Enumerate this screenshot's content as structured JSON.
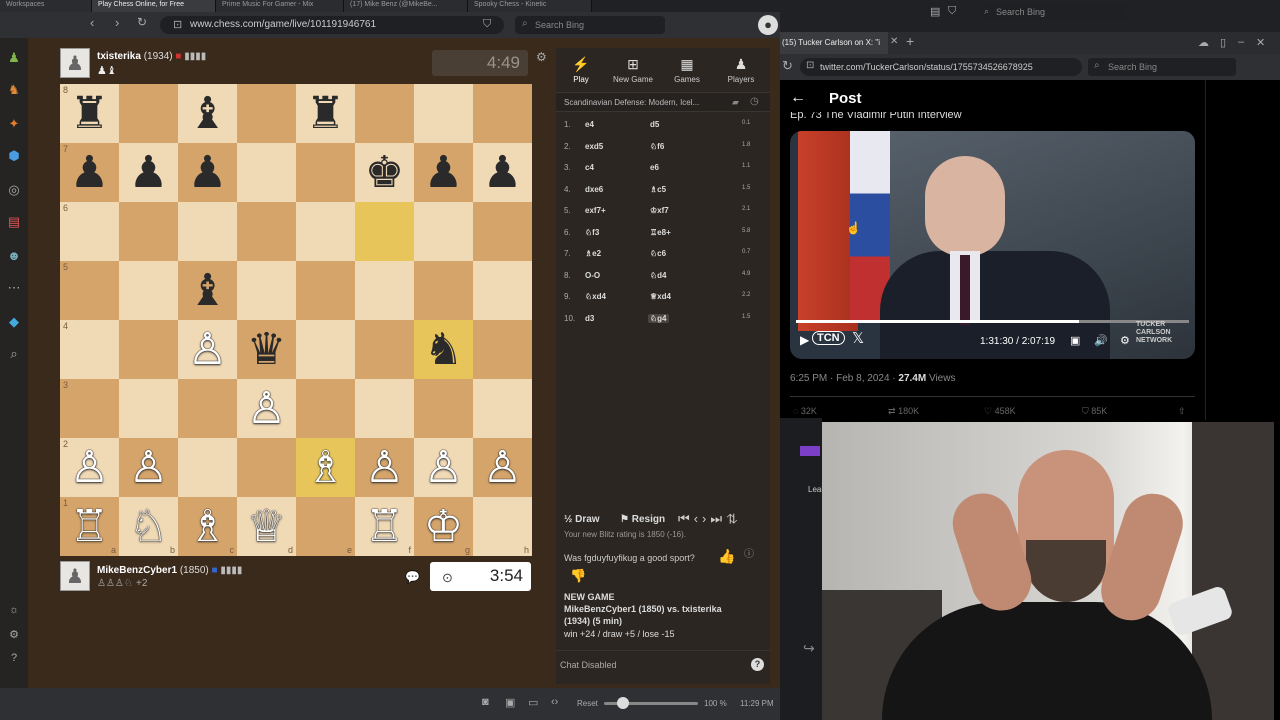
{
  "left_browser": {
    "tabs": [
      "Workspaces",
      "Play Chess Online, for Free",
      "Prime Music For Gamer - Mix",
      "(17) Mike Benz (@MikeBe...",
      "Spooky Chess - Kinetic"
    ],
    "url": "www.chess.com/game/live/101191946761",
    "search_placeholder": "Search Bing"
  },
  "top_player": {
    "name": "txisterika",
    "rating": "(1934)",
    "clock": "4:49",
    "captured": "♟♝"
  },
  "bottom_player": {
    "name": "MikeBenzCyber1",
    "rating": "(1850)",
    "clock": "3:54",
    "captured": "♙♙♙♘",
    "advantage": "+2"
  },
  "board": {
    "ranks": [
      "8",
      "7",
      "6",
      "5",
      "4",
      "3",
      "2",
      "1"
    ],
    "files": [
      "a",
      "b",
      "c",
      "d",
      "e",
      "f",
      "g",
      "h"
    ],
    "rows": [
      [
        "♜",
        "",
        "♝",
        "",
        "♜",
        "",
        "",
        ""
      ],
      [
        "♟",
        "♟",
        "♟",
        "",
        "",
        "♚",
        "♟",
        "♟"
      ],
      [
        "",
        "",
        "",
        "",
        "",
        "",
        "",
        ""
      ],
      [
        "",
        "",
        "♝",
        "",
        "",
        "",
        "",
        ""
      ],
      [
        "",
        "",
        "♙",
        "♛",
        "",
        "",
        "♞",
        ""
      ],
      [
        "",
        "",
        "",
        "♙",
        "",
        "",
        "",
        ""
      ],
      [
        "♙",
        "♙",
        "",
        "",
        "♗",
        "♙",
        "♙",
        "♙"
      ],
      [
        "♖",
        "♘",
        "♗",
        "♕",
        "",
        "♖",
        "♔",
        ""
      ]
    ],
    "colors": [
      [
        "b",
        "",
        "b",
        "",
        "b",
        "",
        "",
        ""
      ],
      [
        "b",
        "b",
        "b",
        "",
        "",
        "b",
        "b",
        "b"
      ],
      [
        "",
        "",
        "",
        "",
        "",
        "",
        "",
        ""
      ],
      [
        "",
        "",
        "b",
        "",
        "",
        "",
        "",
        ""
      ],
      [
        "",
        "",
        "w",
        "b",
        "",
        "",
        "b",
        ""
      ],
      [
        "",
        "",
        "",
        "w",
        "",
        "",
        "",
        ""
      ],
      [
        "w",
        "w",
        "",
        "",
        "w",
        "w",
        "w",
        "w"
      ],
      [
        "w",
        "w",
        "w",
        "w",
        "",
        "w",
        "w",
        ""
      ]
    ],
    "highlighted": [
      "f6",
      "g4",
      "e2"
    ]
  },
  "panel": {
    "tabs": [
      {
        "icon": "⚡",
        "label": "Play"
      },
      {
        "icon": "⊞",
        "label": "New Game"
      },
      {
        "icon": "▦",
        "label": "Games"
      },
      {
        "icon": "♟",
        "label": "Players"
      }
    ],
    "opening": "Scandinavian Defense: Modern, Icel...",
    "moves": [
      {
        "n": "1.",
        "w": "e4",
        "b": "d5",
        "t": "0.1"
      },
      {
        "n": "2.",
        "w": "exd5",
        "b": "♘f6",
        "t": "1.8"
      },
      {
        "n": "3.",
        "w": "c4",
        "b": "e6",
        "t": "1.1"
      },
      {
        "n": "4.",
        "w": "dxe6",
        "b": "♗c5",
        "t": "1.5"
      },
      {
        "n": "5.",
        "w": "exf7+",
        "b": "♔xf7",
        "t": "2.1"
      },
      {
        "n": "6.",
        "w": "♘f3",
        "b": "♖e8+",
        "t": "5.8"
      },
      {
        "n": "7.",
        "w": "♗e2",
        "b": "♘c6",
        "t": "0.7"
      },
      {
        "n": "8.",
        "w": "O-O",
        "b": "♘d4",
        "t": "4.9"
      },
      {
        "n": "9.",
        "w": "♘xd4",
        "b": "♕xd4",
        "t": "2.2"
      },
      {
        "n": "10.",
        "w": "d3",
        "b": "♘g4",
        "t": "1.5"
      }
    ],
    "draw": "Draw",
    "resign": "Resign",
    "rating_msg": "Your new Blitz rating is 1850 (-16).",
    "sport_q": "Was fgduyfuyfikug a good sport?",
    "new_game": "NEW GAME",
    "vs_line": "MikeBenzCyber1 (1850) vs. txisterika",
    "vs_line2": "(1934) (5 min)",
    "odds": "win +24 / draw +5 / lose -15",
    "chat": "Chat Disabled"
  },
  "left_status": {
    "reset": "Reset",
    "zoom": "100 %",
    "time": "11:29 PM"
  },
  "right_browser": {
    "tab_title": "(15) Tucker Carlson on X: \"i",
    "url": "twitter.com/TuckerCarlson/status/1755734526678925",
    "search_placeholder": "Search Bing",
    "top_search": "Search Bing",
    "post_header": "Post",
    "video_caption": "Ep. 73 The Vladimir Putin Interview",
    "video_time": "1:31:30 / 2:07:19",
    "video_brand": "TCN",
    "watermark": "TUCKER CARLSON NETWORK",
    "meta_time": "6:25 PM · Feb 8, 2024 · ",
    "views": "27.4M",
    "views_label": " Views",
    "stats": [
      "32K",
      "180K",
      "458K",
      "85K"
    ],
    "side_label": "Leal"
  },
  "colors": {
    "light_square": "#f0d9b5",
    "dark_square": "#d5a46a",
    "highlight": "#e7c55b",
    "wood": "#3a2a1c"
  }
}
